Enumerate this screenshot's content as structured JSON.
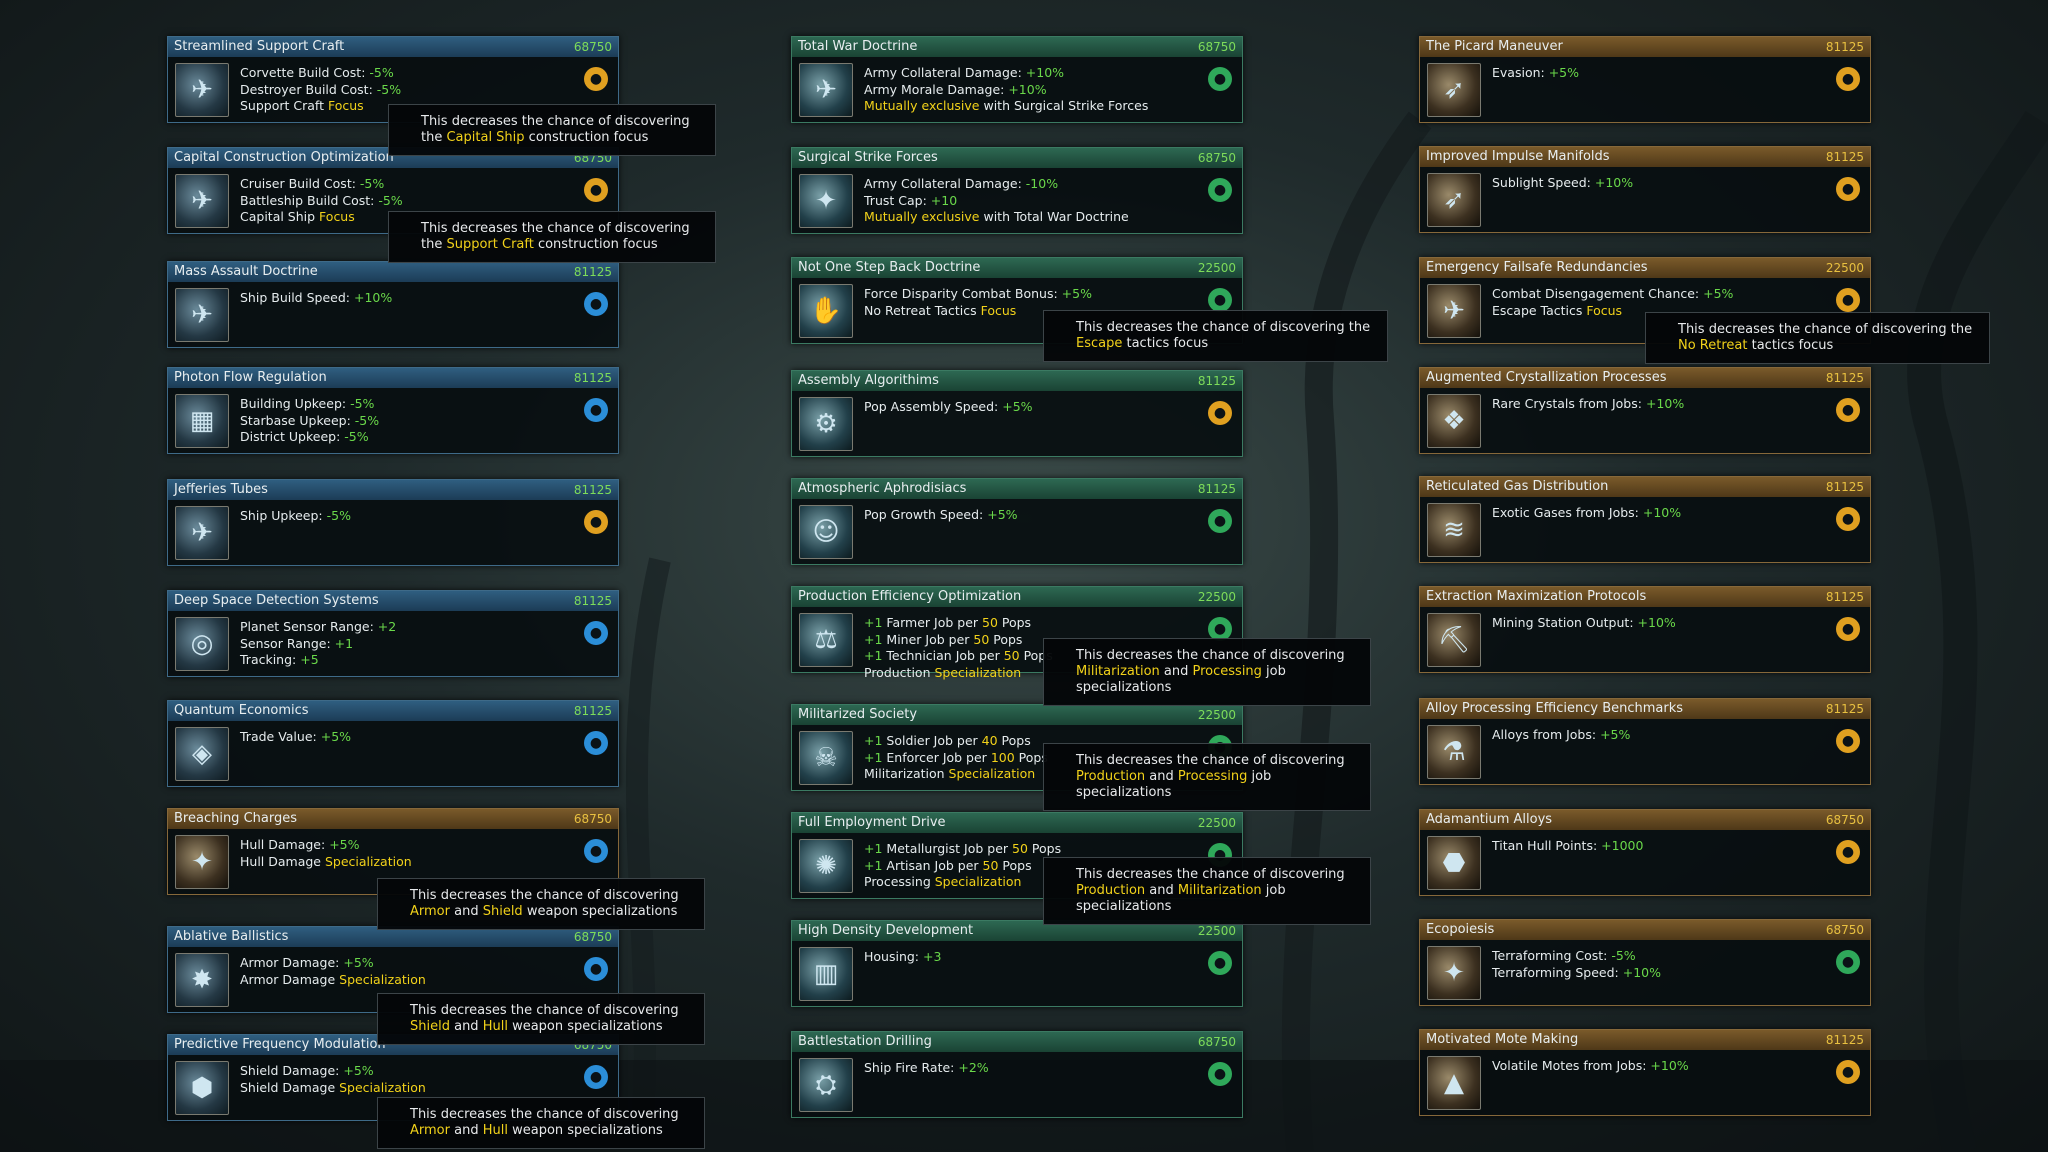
{
  "cards": [
    {
      "title": "Streamlined Support Craft",
      "cost": "68750",
      "color": "blue",
      "icon": "corvette-ship-icon",
      "glyph": "✈",
      "badge": "engineering-rocket-icon",
      "badge_color": "orange",
      "lines": [
        [
          "Corvette Build Cost: ",
          [
            "-5%",
            "neg"
          ]
        ],
        [
          "Destroyer Build Cost: ",
          [
            "-5%",
            "neg"
          ]
        ],
        [
          "Support Craft ",
          [
            "Focus",
            "hl"
          ]
        ]
      ]
    },
    {
      "title": "Capital Construction Optimization",
      "cost": "68750",
      "color": "blue",
      "icon": "cruiser-ship-icon",
      "glyph": "✈",
      "badge": "engineering-rocket-icon",
      "badge_color": "orange",
      "lines": [
        [
          "Cruiser Build Cost: ",
          [
            "-5%",
            "neg"
          ]
        ],
        [
          "Battleship Build Cost: ",
          [
            "-5%",
            "neg"
          ]
        ],
        [
          "Capital Ship ",
          [
            "Focus",
            "hl"
          ]
        ]
      ]
    },
    {
      "title": "Mass Assault Doctrine",
      "cost": "81125",
      "color": "blue",
      "icon": "assault-ships-icon",
      "glyph": "✈",
      "badge": "shipyard-icon",
      "badge_color": "blue",
      "lines": [
        [
          "Ship Build Speed: ",
          [
            "+10%",
            "pos"
          ]
        ]
      ]
    },
    {
      "title": "Photon Flow Regulation",
      "cost": "81125",
      "color": "blue",
      "icon": "upkeep-icon",
      "glyph": "▦",
      "badge": "shipyard-icon",
      "badge_color": "blue",
      "lines": [
        [
          "Building Upkeep: ",
          [
            "-5%",
            "neg"
          ]
        ],
        [
          "Starbase Upkeep: ",
          [
            "-5%",
            "neg"
          ]
        ],
        [
          "District Upkeep: ",
          [
            "-5%",
            "neg"
          ]
        ]
      ]
    },
    {
      "title": "Jefferies Tubes",
      "cost": "81125",
      "color": "blue",
      "icon": "ship-upkeep-icon",
      "glyph": "✈",
      "badge": "engineering-rocket-icon",
      "badge_color": "orange",
      "lines": [
        [
          "Ship Upkeep: ",
          [
            "-5%",
            "neg"
          ]
        ]
      ]
    },
    {
      "title": "Deep Space Detection Systems",
      "cost": "81125",
      "color": "blue",
      "icon": "sensor-icon",
      "glyph": "◎",
      "badge": "shipyard-icon",
      "badge_color": "blue",
      "lines": [
        [
          "Planet Sensor Range: ",
          [
            "+2",
            "pos"
          ]
        ],
        [
          "Sensor Range: ",
          [
            "+1",
            "pos"
          ]
        ],
        [
          "Tracking: ",
          [
            "+5",
            "pos"
          ]
        ]
      ]
    },
    {
      "title": "Quantum Economics",
      "cost": "81125",
      "color": "blue",
      "icon": "trade-icon",
      "glyph": "◈",
      "badge": "shipyard-icon",
      "badge_color": "blue",
      "lines": [
        [
          "Trade Value: ",
          [
            "+5%",
            "pos"
          ]
        ]
      ]
    },
    {
      "title": "Breaching Charges",
      "cost": "68750",
      "color": "orange",
      "icon": "hull-damage-icon",
      "glyph": "✦",
      "badge": "physics-atom-icon",
      "badge_color": "blue",
      "lines": [
        [
          "Hull Damage: ",
          [
            "+5%",
            "pos"
          ]
        ],
        [
          "Hull Damage ",
          [
            "Specialization",
            "hl"
          ]
        ]
      ]
    },
    {
      "title": "Ablative Ballistics",
      "cost": "68750",
      "color": "blue",
      "icon": "armor-damage-icon",
      "glyph": "✸",
      "badge": "physics-atom-icon",
      "badge_color": "blue",
      "lines": [
        [
          "Armor Damage: ",
          [
            "+5%",
            "pos"
          ]
        ],
        [
          "Armor Damage ",
          [
            "Specialization",
            "hl"
          ]
        ]
      ]
    },
    {
      "title": "Predictive Frequency Modulation",
      "cost": "68750",
      "color": "blue",
      "icon": "shield-damage-icon",
      "glyph": "⬢",
      "badge": "physics-atom-icon",
      "badge_color": "blue",
      "lines": [
        [
          "Shield Damage: ",
          [
            "+5%",
            "pos"
          ]
        ],
        [
          "Shield Damage ",
          [
            "Specialization",
            "hl"
          ]
        ]
      ]
    },
    {
      "title": "Total War Doctrine",
      "cost": "68750",
      "color": "green",
      "icon": "army-icon",
      "glyph": "✈",
      "badge": "society-icon",
      "badge_color": "green",
      "lines": [
        [
          "Army Collateral Damage: ",
          [
            "+10%",
            "pos"
          ]
        ],
        [
          "Army Morale Damage: ",
          [
            "+10%",
            "pos"
          ]
        ],
        [
          [
            "Mutually exclusive",
            "hl"
          ],
          " with Surgical Strike Forces"
        ]
      ]
    },
    {
      "title": "Surgical Strike Forces",
      "cost": "68750",
      "color": "green",
      "icon": "strike-forces-icon",
      "glyph": "✦",
      "badge": "society-icon",
      "badge_color": "green",
      "lines": [
        [
          "Army Collateral Damage: ",
          [
            "-10%",
            "neg"
          ]
        ],
        [
          "Trust Cap: ",
          [
            "+10",
            "pos"
          ]
        ],
        [
          [
            "Mutually exclusive",
            "hl"
          ],
          " with Total War Doctrine"
        ]
      ]
    },
    {
      "title": "Not One Step Back Doctrine",
      "cost": "22500",
      "color": "green",
      "icon": "no-retreat-icon",
      "glyph": "✋",
      "badge": "society-icon",
      "badge_color": "green",
      "lines": [
        [
          "Force Disparity Combat Bonus: ",
          [
            "+5%",
            "pos"
          ]
        ],
        [
          "No Retreat Tactics ",
          [
            "Focus",
            "hl"
          ]
        ]
      ]
    },
    {
      "title": "Assembly Algorithims",
      "cost": "81125",
      "color": "green",
      "icon": "pop-assembly-icon",
      "glyph": "⚙",
      "badge": "industry-icon",
      "badge_color": "orange",
      "lines": [
        [
          "Pop Assembly Speed: ",
          [
            "+5%",
            "pos"
          ]
        ]
      ]
    },
    {
      "title": "Atmospheric Aphrodisiacs",
      "cost": "81125",
      "color": "green",
      "icon": "pop-growth-icon",
      "glyph": "☺",
      "badge": "society-icon",
      "badge_color": "green",
      "lines": [
        [
          "Pop Growth Speed: ",
          [
            "+5%",
            "pos"
          ]
        ]
      ]
    },
    {
      "title": "Production Efficiency Optimization",
      "cost": "22500",
      "color": "green",
      "icon": "production-icon",
      "glyph": "⚖",
      "badge": "planet-icon",
      "badge_color": "green",
      "lines": [
        [
          [
            "+1",
            "pos"
          ],
          " Farmer Job per ",
          [
            "50",
            "hl"
          ],
          " Pops"
        ],
        [
          [
            "+1",
            "pos"
          ],
          " Miner Job per ",
          [
            "50",
            "hl"
          ],
          " Pops"
        ],
        [
          [
            "+1",
            "pos"
          ],
          " Technician Job per ",
          [
            "50",
            "hl"
          ],
          " Pops"
        ],
        [
          "Production ",
          [
            "Specialization",
            "hl"
          ]
        ]
      ]
    },
    {
      "title": "Militarized Society",
      "cost": "22500",
      "color": "green",
      "icon": "militarized-icon",
      "glyph": "☠",
      "badge": "planet-icon",
      "badge_color": "green",
      "lines": [
        [
          [
            "+1",
            "pos"
          ],
          " Soldier Job per ",
          [
            "40",
            "hl"
          ],
          " Pops"
        ],
        [
          [
            "+1",
            "pos"
          ],
          " Enforcer Job per ",
          [
            "100",
            "hl"
          ],
          " Pops"
        ],
        [
          "Militarization ",
          [
            "Specialization",
            "hl"
          ]
        ]
      ]
    },
    {
      "title": "Full Employment Drive",
      "cost": "22500",
      "color": "green",
      "icon": "employment-icon",
      "glyph": "✺",
      "badge": "planet-icon",
      "badge_color": "green",
      "lines": [
        [
          [
            "+1",
            "pos"
          ],
          " Metallurgist Job per ",
          [
            "50",
            "hl"
          ],
          " Pops"
        ],
        [
          [
            "+1",
            "pos"
          ],
          " Artisan Job per ",
          [
            "50",
            "hl"
          ],
          " Pops"
        ],
        [
          "Processing ",
          [
            "Specialization",
            "hl"
          ]
        ]
      ]
    },
    {
      "title": "High Density Development",
      "cost": "22500",
      "color": "green",
      "icon": "housing-icon",
      "glyph": "▥",
      "badge": "planet-flag-icon",
      "badge_color": "green",
      "lines": [
        [
          "Housing: ",
          [
            "+3",
            "pos"
          ]
        ]
      ]
    },
    {
      "title": "Battlestation Drilling",
      "cost": "68750",
      "color": "green",
      "icon": "battlestation-icon",
      "glyph": "⛭",
      "badge": "society-icon",
      "badge_color": "green",
      "lines": [
        [
          "Ship Fire Rate: ",
          [
            "+2%",
            "pos"
          ]
        ]
      ]
    },
    {
      "title": "The Picard Maneuver",
      "cost": "81125",
      "color": "orange",
      "icon": "evasion-icon",
      "glyph": "➶",
      "badge": "propulsion-icon",
      "badge_color": "orange",
      "lines": [
        [
          "Evasion: ",
          [
            "+5%",
            "pos"
          ]
        ]
      ]
    },
    {
      "title": "Improved Impulse Manifolds",
      "cost": "81125",
      "color": "orange",
      "icon": "impulse-icon",
      "glyph": "➶",
      "badge": "propulsion-icon",
      "badge_color": "orange",
      "lines": [
        [
          "Sublight Speed: ",
          [
            "+10%",
            "pos"
          ]
        ]
      ]
    },
    {
      "title": "Emergency Failsafe Redundancies",
      "cost": "22500",
      "color": "orange",
      "icon": "failsafe-icon",
      "glyph": "✈",
      "badge": "engineering-rocket-icon",
      "badge_color": "orange",
      "lines": [
        [
          "Combat Disengagement Chance: ",
          [
            "+5%",
            "pos"
          ]
        ],
        [
          "Escape Tactics ",
          [
            "Focus",
            "hl"
          ]
        ]
      ]
    },
    {
      "title": "Augmented Crystallization Processes",
      "cost": "81125",
      "color": "orange",
      "icon": "crystals-icon",
      "glyph": "❖",
      "badge": "materials-icon",
      "badge_color": "orange",
      "lines": [
        [
          "Rare Crystals from  Jobs: ",
          [
            "+10%",
            "pos"
          ]
        ]
      ]
    },
    {
      "title": "Reticulated Gas Distribution",
      "cost": "81125",
      "color": "orange",
      "icon": "gas-icon",
      "glyph": "≋",
      "badge": "materials-icon",
      "badge_color": "orange",
      "lines": [
        [
          "Exotic Gases from  Jobs: ",
          [
            "+10%",
            "pos"
          ]
        ]
      ]
    },
    {
      "title": "Extraction Maximization Protocols",
      "cost": "81125",
      "color": "orange",
      "icon": "mining-icon",
      "glyph": "⛏",
      "badge": "industry-icon",
      "badge_color": "orange",
      "lines": [
        [
          "Mining Station Output: ",
          [
            "+10%",
            "pos"
          ]
        ]
      ]
    },
    {
      "title": "Alloy Processing Efficiency Benchmarks",
      "cost": "81125",
      "color": "orange",
      "icon": "alloys-icon",
      "glyph": "⚗",
      "badge": "industry-icon",
      "badge_color": "orange",
      "lines": [
        [
          "Alloys from  Jobs: ",
          [
            "+5%",
            "pos"
          ]
        ]
      ]
    },
    {
      "title": "Adamantium Alloys",
      "cost": "68750",
      "color": "orange",
      "icon": "titan-hull-icon",
      "glyph": "⬣",
      "badge": "engineering-rocket-icon",
      "badge_color": "orange",
      "lines": [
        [
          "Titan Hull Points: ",
          [
            "+1000",
            "pos"
          ]
        ]
      ]
    },
    {
      "title": "Ecopoiesis",
      "cost": "68750",
      "color": "orange",
      "icon": "terraforming-icon",
      "glyph": "✦",
      "badge": "planet-flag-icon",
      "badge_color": "green",
      "lines": [
        [
          "Terraforming Cost: ",
          [
            "-5%",
            "neg"
          ]
        ],
        [
          "Terraforming Speed: ",
          [
            "+10%",
            "pos"
          ]
        ]
      ]
    },
    {
      "title": "Motivated Mote Making",
      "cost": "81125",
      "color": "orange",
      "icon": "motes-icon",
      "glyph": "▲",
      "badge": "materials-icon",
      "badge_color": "orange",
      "lines": [
        [
          "Volatile Motes from  Jobs: ",
          [
            "+10%",
            "pos"
          ]
        ]
      ]
    }
  ],
  "tooltips": [
    [
      [
        "This decreases the chance of discovering the "
      ],
      [
        "Capital Ship",
        "hl"
      ],
      [
        " construction focus"
      ]
    ],
    [
      [
        "This decreases the chance of discovering the "
      ],
      [
        "Support Craft",
        "hl"
      ],
      [
        " construction focus"
      ]
    ],
    [
      [
        "This decreases the chance of discovering "
      ],
      [
        "Armor",
        "hl"
      ],
      [
        " and "
      ],
      [
        "Shield",
        "hl"
      ],
      [
        " weapon specializations"
      ]
    ],
    [
      [
        "This decreases the chance of discovering "
      ],
      [
        "Shield",
        "hl"
      ],
      [
        " and "
      ],
      [
        "Hull",
        "hl"
      ],
      [
        " weapon specializations"
      ]
    ],
    [
      [
        "This decreases the chance of discovering "
      ],
      [
        "Armor",
        "hl"
      ],
      [
        " and "
      ],
      [
        "Hull",
        "hl"
      ],
      [
        " weapon specializations"
      ]
    ],
    [
      [
        "This decreases the chance of discovering the "
      ],
      [
        "Escape",
        "hl"
      ],
      [
        " tactics focus"
      ]
    ],
    [
      [
        "This decreases the chance of discovering "
      ],
      [
        "Militarization",
        "hl"
      ],
      [
        " and "
      ],
      [
        "Processing",
        "hl"
      ],
      [
        " job specializations"
      ]
    ],
    [
      [
        "This decreases the chance of discovering "
      ],
      [
        "Production",
        "hl"
      ],
      [
        " and "
      ],
      [
        "Processing",
        "hl"
      ],
      [
        " job specializations"
      ]
    ],
    [
      [
        "This decreases the chance of discovering "
      ],
      [
        "Production",
        "hl"
      ],
      [
        " and "
      ],
      [
        "Militarization",
        "hl"
      ],
      [
        " job specializations"
      ]
    ],
    [
      [
        "This decreases the chance of discovering the "
      ],
      [
        "No Retreat",
        "hl"
      ],
      [
        " tactics focus"
      ]
    ]
  ]
}
